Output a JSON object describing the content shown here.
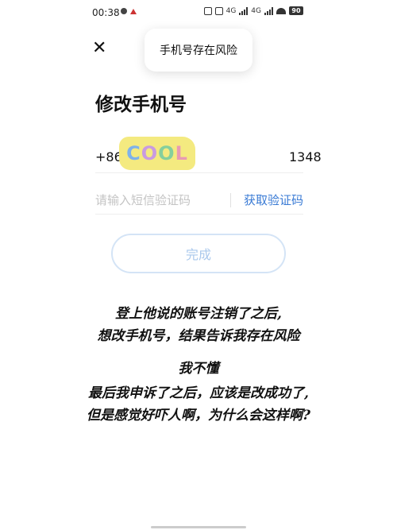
{
  "status_bar": {
    "time": "00:38",
    "network_a": "4G",
    "network_b": "4G",
    "battery": "90"
  },
  "toast": {
    "text": "手机号存在风险"
  },
  "page": {
    "title": "修改手机号"
  },
  "phone": {
    "prefix": "+86",
    "suffix": "1348",
    "sticker_text": "COOL"
  },
  "code": {
    "placeholder": "请输入短信验证码",
    "get_code_label": "获取验证码"
  },
  "done_button": {
    "label": "完成"
  },
  "caption": {
    "lines": [
      "登上他说的账号注销了之后,",
      "想改手机号，结果告诉我存在风险",
      "我不懂",
      "最后我申诉了之后，应该是改成功了,",
      "但是感觉好吓人啊，为什么会这样啊?"
    ]
  },
  "colors": {
    "accent": "#3a7bd5",
    "button_border": "#d4e4f6",
    "button_text": "#aac8ec",
    "sticker_bg": "#f4ea80"
  }
}
